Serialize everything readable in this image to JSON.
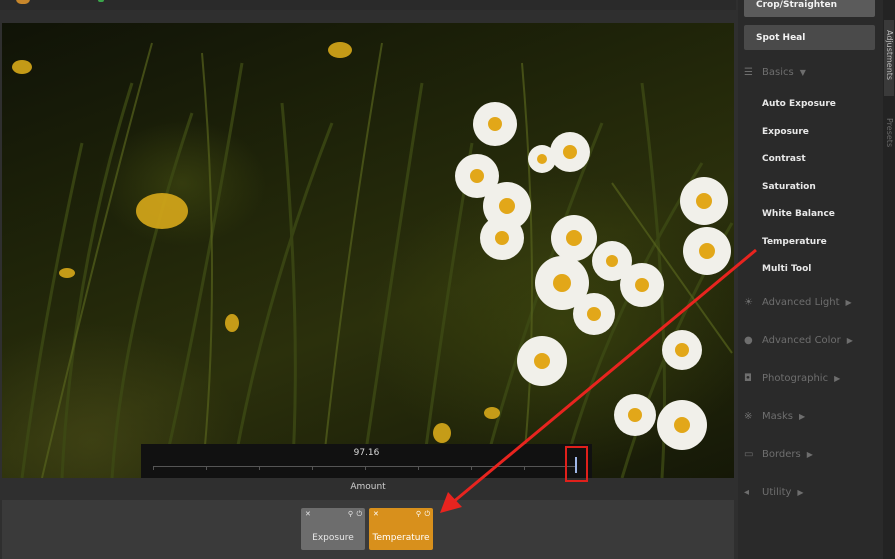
{
  "panel": {
    "crop_label": "Crop/Straighten",
    "spot_label": "Spot Heal",
    "sections": {
      "basics": "Basics",
      "advanced_light": "Advanced Light",
      "advanced_color": "Advanced Color",
      "photographic": "Photographic",
      "masks": "Masks",
      "borders": "Borders",
      "utility": "Utility"
    },
    "basics_tools": [
      "Auto Exposure",
      "Exposure",
      "Contrast",
      "Saturation",
      "White Balance",
      "Temperature",
      "Multi Tool"
    ]
  },
  "tabs": {
    "adjustments": "Adjustments",
    "presets": "Presets"
  },
  "slider": {
    "value": "97.16",
    "label": "Amount",
    "level": 0.9716
  },
  "dock": {
    "exposure": "Exposure",
    "temperature": "Temperature",
    "close_glyph": "✕",
    "pin_glyph": "📌",
    "power_glyph": "⏻"
  },
  "colors": {
    "accent": "#d8901c",
    "highlight": "#e0201b",
    "arrow": "#e8241f"
  },
  "icons": {
    "basics": "sliders-icon",
    "advanced_light": "sun-icon",
    "advanced_color": "palette-icon",
    "photographic": "camera-icon",
    "masks": "mask-icon",
    "borders": "border-icon",
    "utility": "utility-icon"
  }
}
